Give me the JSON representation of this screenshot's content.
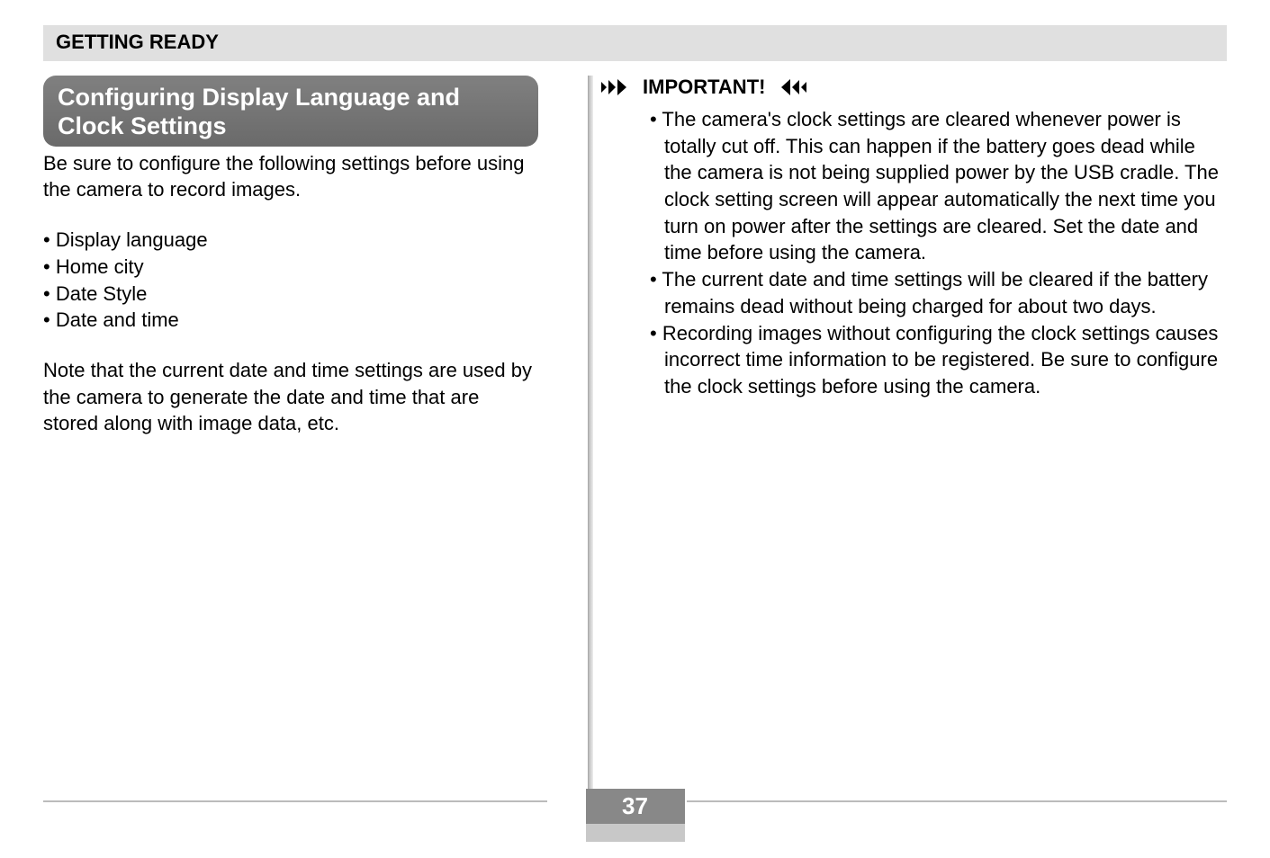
{
  "header": "GETTING READY",
  "section_title": "Configuring Display Language and Clock Settings",
  "left": {
    "intro": "Be sure to configure the following settings before using the camera to record images.",
    "bullets": [
      "Display language",
      "Home city",
      "Date Style",
      "Date and time"
    ],
    "note": "Note that the current date and time settings are used by the camera to generate the date and time that are stored along with image data, etc."
  },
  "right": {
    "important_label": "IMPORTANT!",
    "items": [
      "The camera's clock settings are cleared whenever power is totally cut off. This can happen if the battery goes dead while the camera is not being supplied power by the USB cradle. The clock setting screen will appear automatically the next time you turn on power after the settings are cleared. Set the date and time before using the camera.",
      "The current date and time settings will be cleared if the battery remains dead without being charged for about two days.",
      "Recording images without configuring the clock settings causes incorrect time information to be registered. Be sure to configure the clock settings before using the camera."
    ]
  },
  "page_number": "37"
}
